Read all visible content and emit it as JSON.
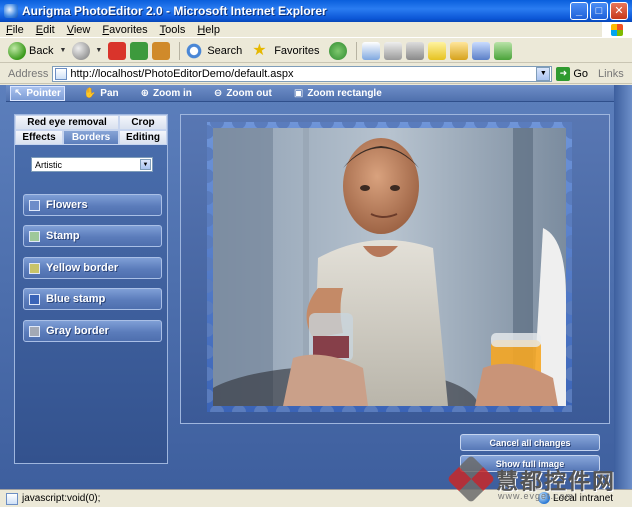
{
  "window": {
    "title": "Aurigma PhotoEditor 2.0 - Microsoft Internet Explorer",
    "buttons": [
      "_",
      "□",
      "✕"
    ]
  },
  "menu": [
    "File",
    "Edit",
    "View",
    "Favorites",
    "Tools",
    "Help"
  ],
  "ie_toolbar": {
    "back": "Back",
    "search": "Search",
    "favorites": "Favorites"
  },
  "address": {
    "label": "Address",
    "url": "http://localhost/PhotoEditorDemo/default.aspx",
    "go": "Go",
    "links": "Links"
  },
  "app_toolbar": {
    "tools": [
      {
        "label": "Pointer",
        "icon": "pointer-icon",
        "active": true
      },
      {
        "label": "Pan",
        "icon": "hand-icon",
        "active": false
      },
      {
        "label": "Zoom in",
        "icon": "zoom-in-icon",
        "active": false
      },
      {
        "label": "Zoom out",
        "icon": "zoom-out-icon",
        "active": false
      },
      {
        "label": "Zoom rectangle",
        "icon": "zoom-rectangle-icon",
        "active": false
      }
    ]
  },
  "panel": {
    "tabs_row1": [
      "Red eye removal",
      "Crop"
    ],
    "tabs_row2": [
      "Effects",
      "Borders",
      "Editing"
    ],
    "active_tab": "Borders",
    "category": "Artistic",
    "effects": [
      {
        "label": "Flowers",
        "color": "#6d8cc9"
      },
      {
        "label": "Stamp",
        "color": "#9ec89a"
      },
      {
        "label": "Yellow border",
        "color": "#c8c46a"
      },
      {
        "label": "Blue stamp",
        "color": "#3a64b8"
      },
      {
        "label": "Gray border",
        "color": "#a3a9b5"
      }
    ]
  },
  "actions": {
    "cancel": "Cancel all changes",
    "show_full": "Show full image"
  },
  "status": {
    "text": "javascript:void(0);",
    "zone": "Local intranet"
  },
  "watermark": {
    "text": "慧都控件网",
    "sub": "www.evget.com"
  },
  "colors": {
    "app_bg": "#4a6cac",
    "stamp_bg": "#4571c4",
    "tab_active": "#5d7fbc"
  }
}
